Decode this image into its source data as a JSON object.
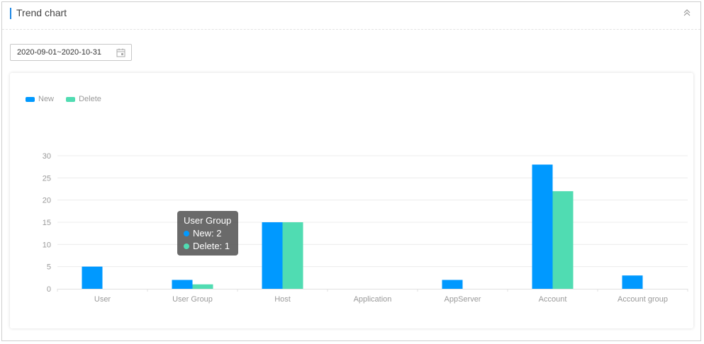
{
  "panel": {
    "title": "Trend chart",
    "collapse_icon": "double-chevron-up-icon"
  },
  "date_range": {
    "value": "2020-09-01~2020-10-31",
    "icon": "calendar-icon"
  },
  "colors": {
    "new": "#0099ff",
    "delete": "#50dcb2",
    "accent": "#1e88e5"
  },
  "legend": [
    {
      "label": "New"
    },
    {
      "label": "Delete"
    }
  ],
  "tooltip": {
    "title": "User Group",
    "new_text": "New: 2",
    "delete_text": "Delete: 1"
  },
  "chart_data": {
    "type": "bar",
    "title": "",
    "xlabel": "",
    "ylabel": "",
    "categories": [
      "User",
      "User Group",
      "Host",
      "Application",
      "AppServer",
      "Account",
      "Account group"
    ],
    "series": [
      {
        "name": "New",
        "values": [
          5,
          2,
          15,
          0,
          2,
          28,
          3
        ]
      },
      {
        "name": "Delete",
        "values": [
          0,
          1,
          15,
          0,
          0,
          22,
          0
        ]
      }
    ],
    "ylim": [
      0,
      30
    ],
    "yticks": [
      0,
      5,
      10,
      15,
      20,
      25,
      30
    ],
    "grid": true,
    "legend_position": "top-left"
  }
}
